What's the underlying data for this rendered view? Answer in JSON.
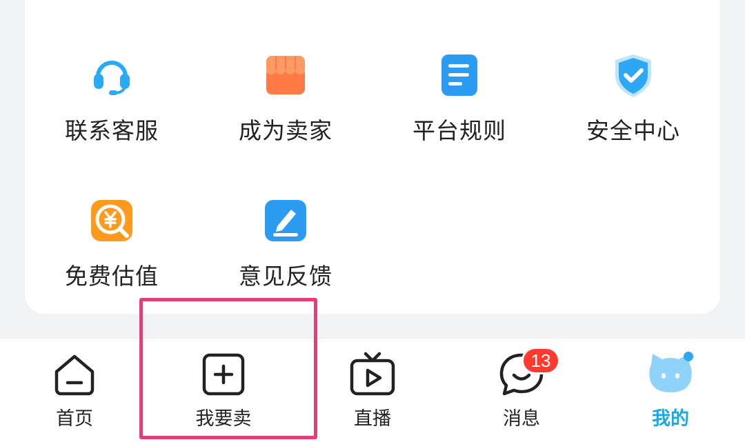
{
  "services": [
    {
      "label": "联系客服",
      "icon": "headset-icon"
    },
    {
      "label": "成为卖家",
      "icon": "storefront-icon"
    },
    {
      "label": "平台规则",
      "icon": "document-icon"
    },
    {
      "label": "安全中心",
      "icon": "shield-icon"
    },
    {
      "label": "免费估值",
      "icon": "yuan-search-icon"
    },
    {
      "label": "意见反馈",
      "icon": "edit-icon"
    }
  ],
  "tabbar": {
    "home": "首页",
    "sell": "我要卖",
    "live": "直播",
    "messages": "消息",
    "messages_badge": "13",
    "me": "我的"
  },
  "colors": {
    "active_tab": "#1aa7e8",
    "badge": "#ff3b2f",
    "highlight": "#e0407a"
  }
}
